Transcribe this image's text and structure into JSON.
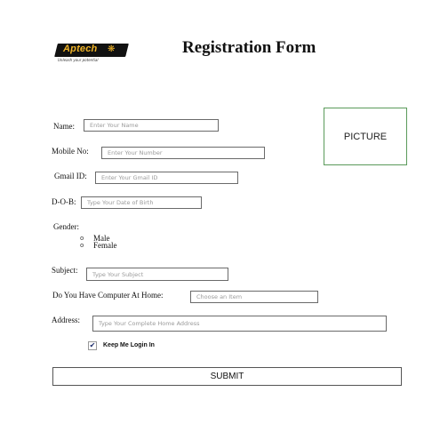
{
  "header": {
    "logo_text": "Aptech",
    "logo_tagline": "Unleash your potential",
    "title": "Registration Form"
  },
  "picture": {
    "label": "PICTURE"
  },
  "form": {
    "name": {
      "label": "Name:",
      "placeholder": "Enter Your Name"
    },
    "mobile": {
      "label": "Mobile No:",
      "placeholder": "Enter Your Number"
    },
    "gmail": {
      "label": "Gmail ID:",
      "placeholder": "Enter Your Gmail ID"
    },
    "dob": {
      "label": "D-O-B:",
      "placeholder": "Type Your Date of Birth"
    },
    "gender": {
      "label": "Gender:",
      "options": [
        "Male",
        "Female"
      ],
      "bullet": "o"
    },
    "subject": {
      "label": "Subject:",
      "placeholder": "Type Your Subject"
    },
    "computer": {
      "label": "Do You Have Computer At Home:",
      "placeholder": "Choose an Item"
    },
    "address": {
      "label": "Address:",
      "placeholder": "Type Your Complete Home Address"
    },
    "keep_logged_in": {
      "label": "Keep Me Login In",
      "checked": true,
      "check_glyph": "✔"
    },
    "submit_label": "SUBMIT"
  },
  "colors": {
    "logo_background": "#111111",
    "logo_text": "#f0b428",
    "picture_border": "#5a9a5a",
    "field_border": "#6a6a6a"
  },
  "icons": {
    "logo_mark": "paw-icon",
    "checkbox_mark": "checkmark-icon"
  }
}
